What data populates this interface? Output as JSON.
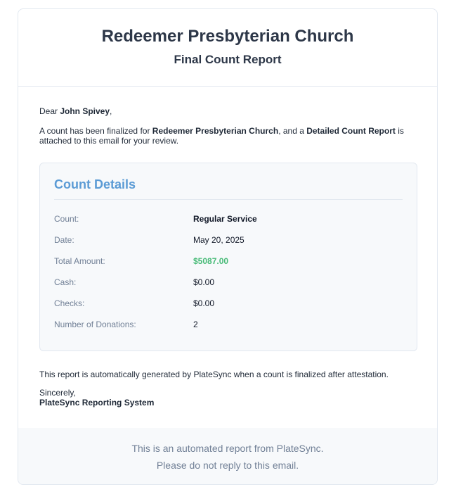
{
  "header": {
    "org_name": "Redeemer Presbyterian Church",
    "report_title": "Final Count Report"
  },
  "body": {
    "greeting_prefix": "Dear ",
    "recipient": "John Spivey",
    "greeting_suffix": ",",
    "intro_part1": "A count has been finalized for ",
    "intro_org": "Redeemer Presbyterian Church",
    "intro_part2": ", and a ",
    "intro_report": "Detailed Count Report",
    "intro_part3": " is attached to this email for your review."
  },
  "details": {
    "title": "Count Details",
    "rows": [
      {
        "label": "Count:",
        "value": "Regular Service"
      },
      {
        "label": "Date:",
        "value": "May 20, 2025"
      },
      {
        "label": "Total Amount:",
        "value": "$5087.00"
      },
      {
        "label": "Cash:",
        "value": "$0.00"
      },
      {
        "label": "Checks:",
        "value": "$0.00"
      },
      {
        "label": "Number of Donations:",
        "value": "2"
      }
    ],
    "total_color": "#48bb78",
    "title_color": "#5b9bd5"
  },
  "closing": {
    "note": "This report is automatically generated by PlateSync when a count is finalized after attestation.",
    "sincerely": "Sincerely,",
    "sender": "PlateSync Reporting System"
  },
  "footer": {
    "line1": "This is an automated report from PlateSync.",
    "line2": "Please do not reply to this email."
  }
}
